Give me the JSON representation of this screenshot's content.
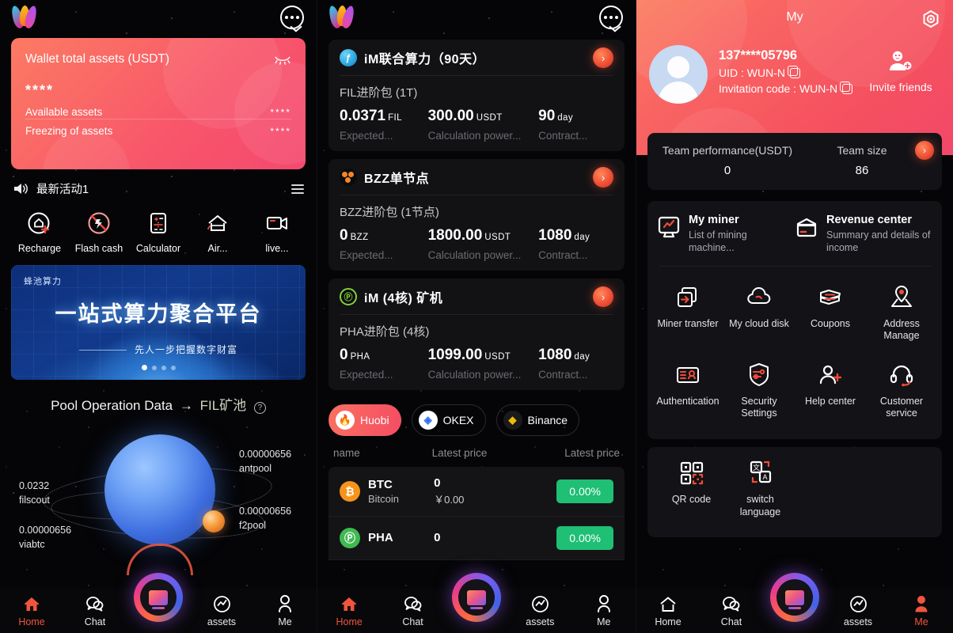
{
  "left": {
    "wallet": {
      "title": "Wallet total assets (USDT)",
      "amount": "****",
      "available_label": "Available assets",
      "available_value": "****",
      "freezing_label": "Freezing of assets",
      "freezing_value": "****"
    },
    "notice": {
      "text": "最新活动1"
    },
    "quick_actions": [
      {
        "label": "Recharge",
        "icon": "recharge-icon"
      },
      {
        "label": "Flash cash",
        "icon": "flash-cash-icon"
      },
      {
        "label": "Calculator",
        "icon": "calculator-icon"
      },
      {
        "label": "Air...",
        "icon": "airdrop-icon"
      },
      {
        "label": "live...",
        "icon": "live-video-icon"
      }
    ],
    "banner": {
      "tag": "蜂池算力",
      "headline": "一站式算力聚合平台",
      "subline": "先人一步把握数字财富",
      "dots": 4,
      "active_dot": 1
    },
    "pool": {
      "title": "Pool Operation Data",
      "arrow": "→",
      "pool_name": "FIL矿池",
      "help": "?"
    },
    "pool_labels": [
      {
        "value": "0.00000656",
        "name": "antpool"
      },
      {
        "value": "0.0232",
        "name": "filscout"
      },
      {
        "value": "0.00000656",
        "name": "f2pool"
      },
      {
        "value": "0.00000656",
        "name": "viabtc"
      }
    ],
    "tabs": [
      {
        "label": "Home",
        "icon": "home-icon",
        "active": true
      },
      {
        "label": "Chat",
        "icon": "chat-icon",
        "active": false
      },
      {
        "label": "assets",
        "icon": "assets-icon",
        "active": false
      },
      {
        "label": "Me",
        "icon": "me-icon",
        "active": false
      }
    ]
  },
  "middle": {
    "packages": [
      {
        "icon": "fil-coin-icon",
        "title": "iM联合算力（90天）",
        "subtitle": "FIL进阶包 (1T)",
        "stat1_value": "0.0371",
        "stat1_unit": "FIL",
        "stat1_label": "Expected...",
        "stat2_value": "300.00",
        "stat2_unit": "USDT",
        "stat2_label": "Calculation power...",
        "stat3_value": "90",
        "stat3_unit": "day",
        "stat3_label": "Contract..."
      },
      {
        "icon": "bzz-coin-icon",
        "title": "BZZ单节点",
        "subtitle": "BZZ进阶包 (1节点)",
        "stat1_value": "0",
        "stat1_unit": "BZZ",
        "stat1_label": "Expected...",
        "stat2_value": "1800.00",
        "stat2_unit": "USDT",
        "stat2_label": "Calculation power...",
        "stat3_value": "1080",
        "stat3_unit": "day",
        "stat3_label": "Contract..."
      },
      {
        "icon": "pha-coin-icon",
        "title": "iM (4核) 矿机",
        "subtitle": "PHA进阶包 (4核)",
        "stat1_value": "0",
        "stat1_unit": "PHA",
        "stat1_label": "Expected...",
        "stat2_value": "1099.00",
        "stat2_unit": "USDT",
        "stat2_label": "Calculation power...",
        "stat3_value": "1080",
        "stat3_unit": "day",
        "stat3_label": "Contract..."
      }
    ],
    "exchanges": [
      {
        "label": "Huobi",
        "active": true
      },
      {
        "label": "OKEX",
        "active": false
      },
      {
        "label": "Binance",
        "active": false
      }
    ],
    "table": {
      "headers": [
        "name",
        "Latest price",
        "Latest price"
      ],
      "rows": [
        {
          "symbol": "BTC",
          "full": "Bitcoin",
          "price": "0",
          "fiat": "￥0.00",
          "change": "0.00%"
        },
        {
          "symbol": "PHA",
          "full": "",
          "price": "0",
          "fiat": "",
          "change": "0.00%"
        }
      ]
    },
    "tabs": [
      {
        "label": "Home",
        "icon": "home-icon",
        "active": true
      },
      {
        "label": "Chat",
        "icon": "chat-icon",
        "active": false
      },
      {
        "label": "assets",
        "icon": "assets-icon",
        "active": false
      },
      {
        "label": "Me",
        "icon": "me-icon",
        "active": false
      }
    ]
  },
  "right": {
    "title": "My",
    "user": {
      "phone": "137****05796",
      "uid_label": "UID : WUN-N",
      "invite_label": "Invitation code : WUN-N"
    },
    "invite_friends": "Invite friends",
    "team": {
      "performance_label": "Team performance(USDT)",
      "performance_value": "0",
      "size_label": "Team size",
      "size_value": "86"
    },
    "feature_cards": [
      {
        "title": "My miner",
        "desc": "List of mining machine...",
        "icon": "miner-icon"
      },
      {
        "title": "Revenue center",
        "desc": "Summary and details of income",
        "icon": "revenue-icon"
      }
    ],
    "menu": [
      {
        "label": "Miner transfer",
        "icon": "miner-transfer-icon"
      },
      {
        "label": "My cloud disk",
        "icon": "cloud-icon"
      },
      {
        "label": "Coupons",
        "icon": "coupon-icon"
      },
      {
        "label": "Address Manage",
        "icon": "address-pin-icon"
      },
      {
        "label": "Authentication",
        "icon": "id-card-icon"
      },
      {
        "label": "Security Settings",
        "icon": "shield-icon"
      },
      {
        "label": "Help center",
        "icon": "user-plus-icon"
      },
      {
        "label": "Customer service",
        "icon": "headset-icon"
      }
    ],
    "menu2": [
      {
        "label": "QR code",
        "icon": "qr-code-icon"
      },
      {
        "label": "switch language",
        "icon": "translate-icon"
      }
    ],
    "tabs": [
      {
        "label": "Home",
        "icon": "home-icon",
        "active": false
      },
      {
        "label": "Chat",
        "icon": "chat-icon",
        "active": false
      },
      {
        "label": "assets",
        "icon": "assets-icon",
        "active": false
      },
      {
        "label": "Me",
        "icon": "me-icon",
        "active": true
      }
    ]
  },
  "colors": {
    "accent_red": "#f0553c",
    "card_gradient_start": "#fb7c5e",
    "card_gradient_end": "#f2486a",
    "green_badge": "#1fbf75",
    "panel_card": "#131317"
  }
}
